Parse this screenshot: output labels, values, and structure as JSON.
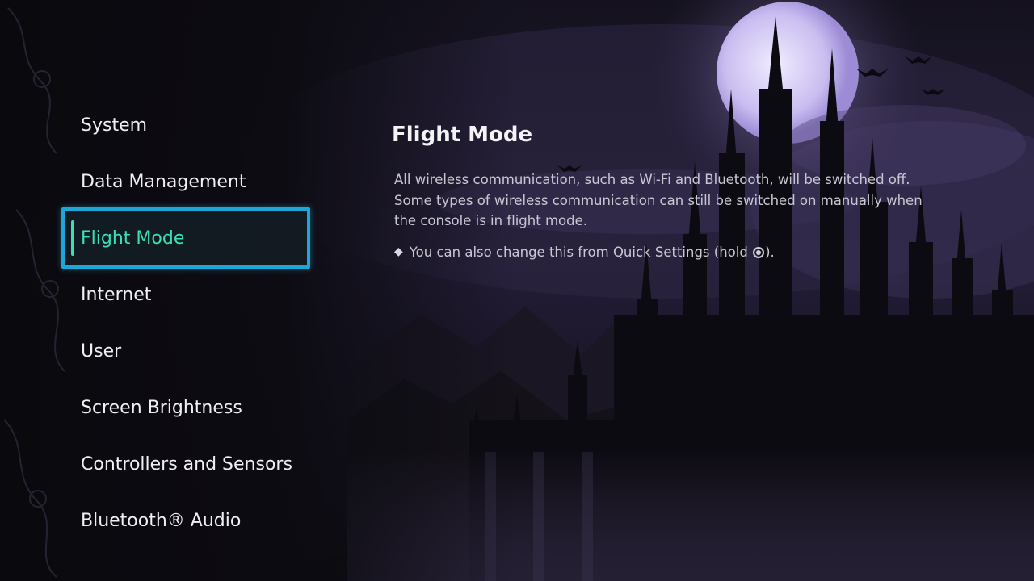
{
  "sidebar": {
    "items": [
      {
        "label": "System",
        "selected": false
      },
      {
        "label": "Data Management",
        "selected": false
      },
      {
        "label": "Flight Mode",
        "selected": true
      },
      {
        "label": "Internet",
        "selected": false
      },
      {
        "label": "User",
        "selected": false
      },
      {
        "label": "Screen Brightness",
        "selected": false
      },
      {
        "label": "Controllers and Sensors",
        "selected": false
      },
      {
        "label": "Bluetooth® Audio",
        "selected": false
      }
    ]
  },
  "detail": {
    "title": "Flight Mode",
    "description_lines": [
      "All wireless communication, such as Wi-Fi and Bluetooth, will be switched off.",
      "Some types of wireless communication can still be switched on manually when",
      "the console is in flight mode."
    ],
    "hint_before": "You can also change this from Quick Settings (hold ",
    "hint_icon": "home-button-icon",
    "hint_after": ")."
  },
  "colors": {
    "selection_border": "#1fa6d6",
    "selection_text": "#39e0b8",
    "background": "#0b0a10"
  }
}
